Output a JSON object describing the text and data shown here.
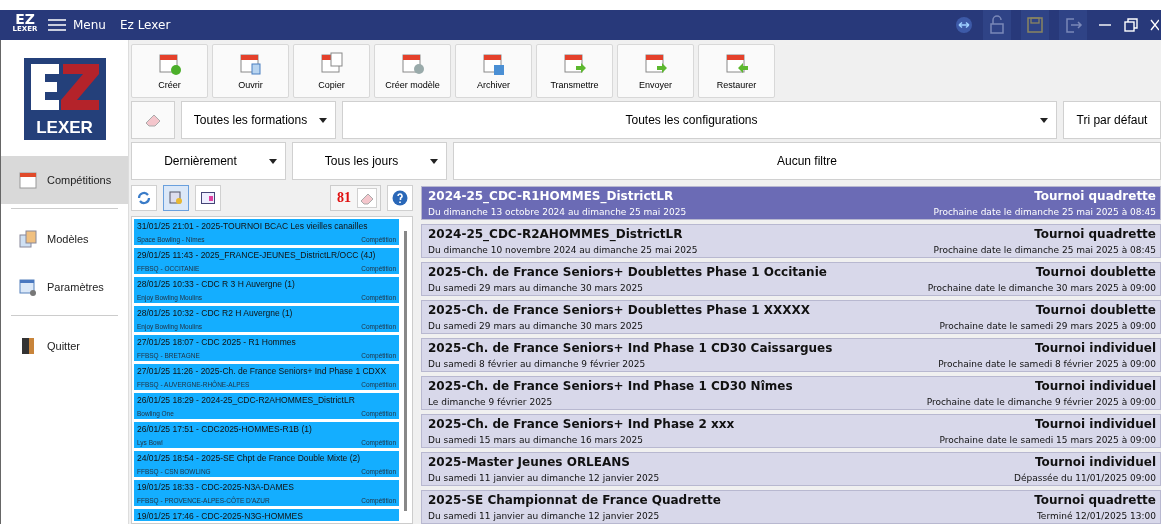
{
  "titlebar": {
    "menu": "Menu",
    "title": "Ez Lexer"
  },
  "logo": {
    "top": "EZ",
    "bottom": "LEXER",
    "sidebar_text": "LEXER"
  },
  "sidebar": {
    "groups": [
      {
        "items": [
          {
            "label": "Compétitions",
            "kind": "calendar",
            "selected": true
          }
        ]
      },
      {
        "items": [
          {
            "label": "Modèles",
            "kind": "models",
            "selected": false
          },
          {
            "label": "Paramètres",
            "kind": "settings",
            "selected": false
          }
        ]
      },
      {
        "items": [
          {
            "label": "Quitter",
            "kind": "door",
            "selected": false
          }
        ]
      }
    ]
  },
  "toolbar": [
    {
      "label": "Créer",
      "kind": "add"
    },
    {
      "label": "Ouvrir",
      "kind": "open"
    },
    {
      "label": "Copier",
      "kind": "copy"
    },
    {
      "label": "Créer modèle",
      "kind": "db"
    },
    {
      "label": "Archiver",
      "kind": "save"
    },
    {
      "label": "Transmettre",
      "kind": "send"
    },
    {
      "label": "Envoyer",
      "kind": "send"
    },
    {
      "label": "Restaurer",
      "kind": "back"
    }
  ],
  "filters": {
    "formations": "Toutes les formations",
    "configurations": "Toutes les configurations",
    "sort": "Tri par défaut",
    "period": "Dernièrement",
    "days": "Tous les jours",
    "filter": "Aucun filtre"
  },
  "recent": {
    "count": "81",
    "view_selected": true,
    "items": [
      {
        "title": "31/01/25 21:01 - 2025-TOURNOI BCAC Les vieilles canailles",
        "place": "Space Bowling - Nîmes",
        "type": "Compétition"
      },
      {
        "title": "29/01/25 11:43 - 2025_FRANCE-JEUNES_DistrictLR/OCC (4J)",
        "place": "FFBSQ - OCCITANIE",
        "type": "Compétition"
      },
      {
        "title": "28/01/25 10:33 - CDC R 3 H Auvergne (1)",
        "place": "Enjoy Bowling Moulins",
        "type": "Compétition"
      },
      {
        "title": "28/01/25 10:32 - CDC R2 H Auvergne (1)",
        "place": "Enjoy Bowling Moulins",
        "type": "Compétition"
      },
      {
        "title": "27/01/25 18:07 - CDC 2025 - R1 Hommes",
        "place": "FFBSQ - BRETAGNE",
        "type": "Compétition"
      },
      {
        "title": "27/01/25 11:26 - 2025-Ch. de France Seniors+ Ind Phase 1 CDXX",
        "place": "FFBSQ - AUVERGNE-RHÔNE-ALPES",
        "type": "Compétition"
      },
      {
        "title": "26/01/25 18:29 - 2024-25_CDC-R2AHOMMES_DistrictLR",
        "place": "Bowling One",
        "type": "Compétition"
      },
      {
        "title": "26/01/25 17:51 - CDC2025-HOMMES-R1B (1)",
        "place": "Lys Bowl",
        "type": "Compétition"
      },
      {
        "title": "24/01/25 18:54 - 2025-SE Chpt de France Double Mixte (2)",
        "place": "FFBSQ - CSN BOWLING",
        "type": "Compétition"
      },
      {
        "title": "19/01/25 18:33 - CDC-2025-N3A-DAMES",
        "place": "FFBSQ - PROVENCE-ALPES-CÔTE D'AZUR",
        "type": "Compétition"
      },
      {
        "title": "19/01/25 17:46 - CDC-2025-N3G-HOMMES"
      }
    ]
  },
  "competitions": [
    {
      "name": "2024-25_CDC-R1HOMMES_DistrictLR",
      "type": "Tournoi quadrette",
      "dates": "Du dimanche 13 octobre 2024 au dimanche 25 mai 2025",
      "next": "Prochaine date le dimanche 25 mai 2025 à 08:45",
      "selected": true
    },
    {
      "name": "2024-25_CDC-R2AHOMMES_DistrictLR",
      "type": "Tournoi quadrette",
      "dates": "Du dimanche 10 novembre 2024 au dimanche 25 mai 2025",
      "next": "Prochaine date le dimanche 25 mai 2025 à 08:45",
      "selected": false
    },
    {
      "name": "2025-Ch. de France Seniors+ Doublettes Phase 1 Occitanie",
      "type": "Tournoi doublette",
      "dates": "Du samedi 29 mars au dimanche 30 mars 2025",
      "next": "Prochaine date le dimanche 30 mars 2025 à 09:00",
      "selected": false
    },
    {
      "name": "2025-Ch. de France Seniors+ Doublettes Phase 1 XXXXX",
      "type": "Tournoi doublette",
      "dates": "Du samedi 29 mars au dimanche 30 mars 2025",
      "next": "Prochaine date le samedi 29 mars 2025 à 09:00",
      "selected": false
    },
    {
      "name": "2025-Ch. de France Seniors+ Ind Phase 1 CD30 Caissargues",
      "type": "Tournoi individuel",
      "dates": "Du samedi 8 février au dimanche 9 février 2025",
      "next": "Prochaine date le samedi 8 février 2025 à 09:00",
      "selected": false
    },
    {
      "name": "2025-Ch. de France Seniors+ Ind Phase 1 CD30 Nîmes",
      "type": "Tournoi individuel",
      "dates": "Le dimanche 9 février 2025",
      "next": "Prochaine date le dimanche 9 février 2025 à 09:00",
      "selected": false
    },
    {
      "name": "2025-Ch. de France Seniors+ Ind Phase 2 xxx",
      "type": "Tournoi individuel",
      "dates": "Du samedi 15 mars au dimanche 16 mars 2025",
      "next": "Prochaine date le samedi 15 mars 2025 à 09:00",
      "selected": false
    },
    {
      "name": "2025-Master Jeunes ORLEANS",
      "type": "Tournoi individuel",
      "dates": "Du samedi 11 janvier au dimanche 12 janvier 2025",
      "next": "Dépassée du 11/01/2025 09:00",
      "selected": false
    },
    {
      "name": "2025-SE Championnat de France Quadrette",
      "type": "Tournoi quadrette",
      "dates": "Du samedi 11 janvier au dimanche 12 janvier 2025",
      "next": "Terminé 12/01/2025 13:00",
      "selected": false
    }
  ]
}
